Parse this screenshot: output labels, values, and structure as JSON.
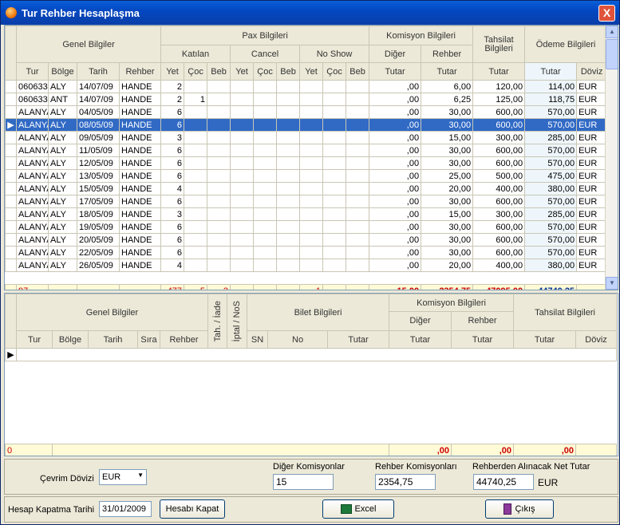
{
  "window": {
    "title": "Tur Rehber Hesaplaşma",
    "close": "X"
  },
  "top": {
    "groups": [
      "Genel Bilgiler",
      "Pax Bilgileri",
      "Komisyon Bilgileri",
      "Tahsilat Bilgileri",
      "Ödeme Bilgileri"
    ],
    "subgroups": [
      "Katılan",
      "Cancel",
      "No Show",
      "Diğer",
      "Rehber"
    ],
    "columns": [
      "Tur",
      "Bölge",
      "Tarih",
      "Rehber",
      "Yet",
      "Çoc",
      "Beb",
      "Yet",
      "Çoc",
      "Beb",
      "Yet",
      "Çoc",
      "Beb",
      "Tutar",
      "Tutar",
      "Tutar",
      "Tutar",
      "Döviz"
    ],
    "rows": [
      [
        "060633",
        "ALY",
        "14/07/09",
        "HANDE",
        "2",
        "",
        "",
        "",
        "",
        "",
        "",
        "",
        "",
        ",00",
        "6,00",
        "120,00",
        "114,00",
        "EUR"
      ],
      [
        "060633",
        "ANT",
        "14/07/09",
        "HANDE",
        "2",
        "1",
        "",
        "",
        "",
        "",
        "",
        "",
        "",
        ",00",
        "6,25",
        "125,00",
        "118,75",
        "EUR"
      ],
      [
        "ALANYA",
        "ALY",
        "04/05/09",
        "HANDE",
        "6",
        "",
        "",
        "",
        "",
        "",
        "",
        "",
        "",
        ",00",
        "30,00",
        "600,00",
        "570,00",
        "EUR"
      ],
      [
        "ALANYA",
        "ALY",
        "08/05/09",
        "HANDE",
        "6",
        "",
        "",
        "",
        "",
        "",
        "",
        "",
        "",
        ",00",
        "30,00",
        "600,00",
        "570,00",
        "EUR"
      ],
      [
        "ALANYA",
        "ALY",
        "09/05/09",
        "HANDE",
        "3",
        "",
        "",
        "",
        "",
        "",
        "",
        "",
        "",
        ",00",
        "15,00",
        "300,00",
        "285,00",
        "EUR"
      ],
      [
        "ALANYA",
        "ALY",
        "11/05/09",
        "HANDE",
        "6",
        "",
        "",
        "",
        "",
        "",
        "",
        "",
        "",
        ",00",
        "30,00",
        "600,00",
        "570,00",
        "EUR"
      ],
      [
        "ALANYA",
        "ALY",
        "12/05/09",
        "HANDE",
        "6",
        "",
        "",
        "",
        "",
        "",
        "",
        "",
        "",
        ",00",
        "30,00",
        "600,00",
        "570,00",
        "EUR"
      ],
      [
        "ALANYA",
        "ALY",
        "13/05/09",
        "HANDE",
        "6",
        "",
        "",
        "",
        "",
        "",
        "",
        "",
        "",
        ",00",
        "25,00",
        "500,00",
        "475,00",
        "EUR"
      ],
      [
        "ALANYA",
        "ALY",
        "15/05/09",
        "HANDE",
        "4",
        "",
        "",
        "",
        "",
        "",
        "",
        "",
        "",
        ",00",
        "20,00",
        "400,00",
        "380,00",
        "EUR"
      ],
      [
        "ALANYA",
        "ALY",
        "17/05/09",
        "HANDE",
        "6",
        "",
        "",
        "",
        "",
        "",
        "",
        "",
        "",
        ",00",
        "30,00",
        "600,00",
        "570,00",
        "EUR"
      ],
      [
        "ALANYA",
        "ALY",
        "18/05/09",
        "HANDE",
        "3",
        "",
        "",
        "",
        "",
        "",
        "",
        "",
        "",
        ",00",
        "15,00",
        "300,00",
        "285,00",
        "EUR"
      ],
      [
        "ALANYA",
        "ALY",
        "19/05/09",
        "HANDE",
        "6",
        "",
        "",
        "",
        "",
        "",
        "",
        "",
        "",
        ",00",
        "30,00",
        "600,00",
        "570,00",
        "EUR"
      ],
      [
        "ALANYA",
        "ALY",
        "20/05/09",
        "HANDE",
        "6",
        "",
        "",
        "",
        "",
        "",
        "",
        "",
        "",
        ",00",
        "30,00",
        "600,00",
        "570,00",
        "EUR"
      ],
      [
        "ALANYA",
        "ALY",
        "22/05/09",
        "HANDE",
        "6",
        "",
        "",
        "",
        "",
        "",
        "",
        "",
        "",
        ",00",
        "30,00",
        "600,00",
        "570,00",
        "EUR"
      ],
      [
        "ALANYA",
        "ALY",
        "26/05/09",
        "HANDE",
        "4",
        "",
        "",
        "",
        "",
        "",
        "",
        "",
        "",
        ",00",
        "20,00",
        "400,00",
        "380,00",
        "EUR"
      ]
    ],
    "selected_row": 3,
    "footer": [
      "97",
      "",
      "",
      "",
      "477",
      "5",
      "2",
      "",
      "",
      "",
      "1",
      "",
      "",
      "15,00",
      "2354,75",
      "47095,00",
      "44740,25",
      ""
    ]
  },
  "bottom": {
    "groups": [
      "Genel Bilgiler",
      "Tah. / İade",
      "İptal / NoS",
      "Bilet Bilgileri",
      "Komisyon Bilgileri",
      "Tahsilat Bilgileri"
    ],
    "subgroups": [
      "Diğer",
      "Rehber"
    ],
    "columns": [
      "Tur",
      "Bölge",
      "Tarih",
      "Sıra",
      "Rehber",
      "SN",
      "No",
      "Tutar",
      "Tutar",
      "Tutar",
      "Tutar",
      "Döviz"
    ],
    "footer": [
      "0",
      ",00",
      ",00",
      ",00"
    ]
  },
  "summary": {
    "currency_label": "Çevrim Dövizi",
    "currency_value": "EUR",
    "other_comm_label": "Diğer Komisyonlar",
    "other_comm_value": "15",
    "guide_comm_label": "Rehber Komisyonları",
    "guide_comm_value": "2354,75",
    "net_label": "Rehberden Alınacak Net Tutar",
    "net_value": "44740,25",
    "net_currency": "EUR"
  },
  "actions": {
    "close_date_label": "Hesap Kapatma Tarihi",
    "close_date_value": "31/01/2009",
    "close_account": "Hesabı Kapat",
    "excel": "Excel",
    "exit": "Çıkış"
  }
}
